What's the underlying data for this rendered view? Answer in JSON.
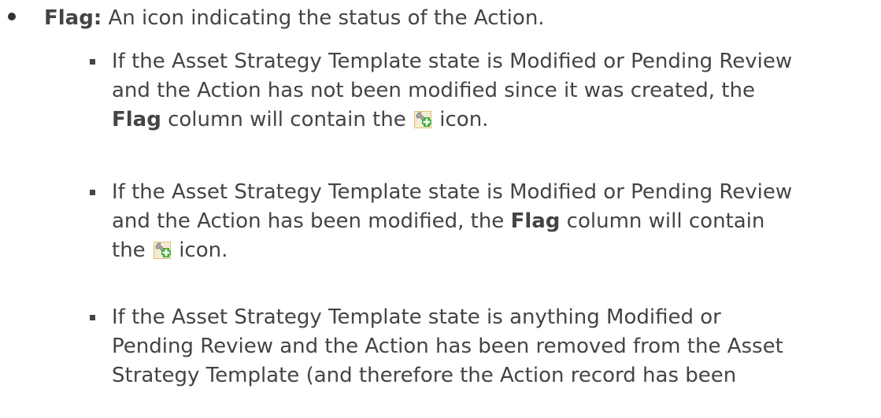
{
  "main_bullet": {
    "term": "Flag:",
    "description": " An icon indicating the status of the Action."
  },
  "sub_items": [
    {
      "line1": "If the Asset Strategy Template state is Modified or Pending Review",
      "line2": "and the Action has not been modified since it was created, the",
      "flag_word": "Flag",
      "line3_mid": " column will contain the ",
      "line3_end": " icon.",
      "icon": "wrench-plus-icon"
    },
    {
      "line1": "If the Asset Strategy Template state is Modified or Pending Review",
      "line2_start": "and the Action has been modified, the ",
      "flag_word": "Flag",
      "line2_end": " column will contain",
      "line3_start": "the ",
      "line3_end": " icon.",
      "icon": "wrench-plus-icon"
    },
    {
      "line1": "If the Asset Strategy Template state is anything Modified or",
      "line2": "Pending Review and the Action has been removed from the Asset",
      "line3": "Strategy Template (and therefore the Action record has been"
    }
  ],
  "colors": {
    "text": "#444444",
    "wrench_body": "#a8a8a8",
    "wrench_frame": "#e0c070",
    "plus_green": "#3aa832"
  }
}
